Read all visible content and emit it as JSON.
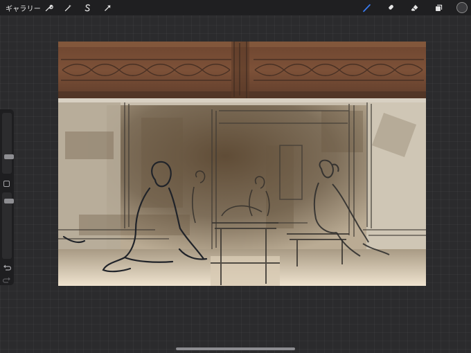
{
  "toolbar": {
    "gallery_label": "ギャラリー",
    "left_tools": [
      {
        "name": "actions",
        "icon": "wrench-icon"
      },
      {
        "name": "adjustments",
        "icon": "magic-wand-icon"
      },
      {
        "name": "selection",
        "icon": "selection-s-icon"
      },
      {
        "name": "transform",
        "icon": "arrow-cursor-icon"
      }
    ],
    "right_tools": [
      {
        "name": "brush",
        "icon": "brush-icon",
        "active": true
      },
      {
        "name": "smudge",
        "icon": "smudge-finger-icon",
        "active": false
      },
      {
        "name": "eraser",
        "icon": "eraser-icon",
        "active": false
      },
      {
        "name": "layers",
        "icon": "layers-icon",
        "active": false
      }
    ],
    "current_color": "#3b3b3e"
  },
  "sidebar": {
    "brush_size_level": 0.3,
    "opacity_level": 0.7,
    "undo_icon": "undo-icon",
    "redo_icon": "redo-icon"
  },
  "colors": {
    "accent": "#3a7bf0",
    "background": "#2b2b2d",
    "toolbar": "#1f1f21"
  }
}
